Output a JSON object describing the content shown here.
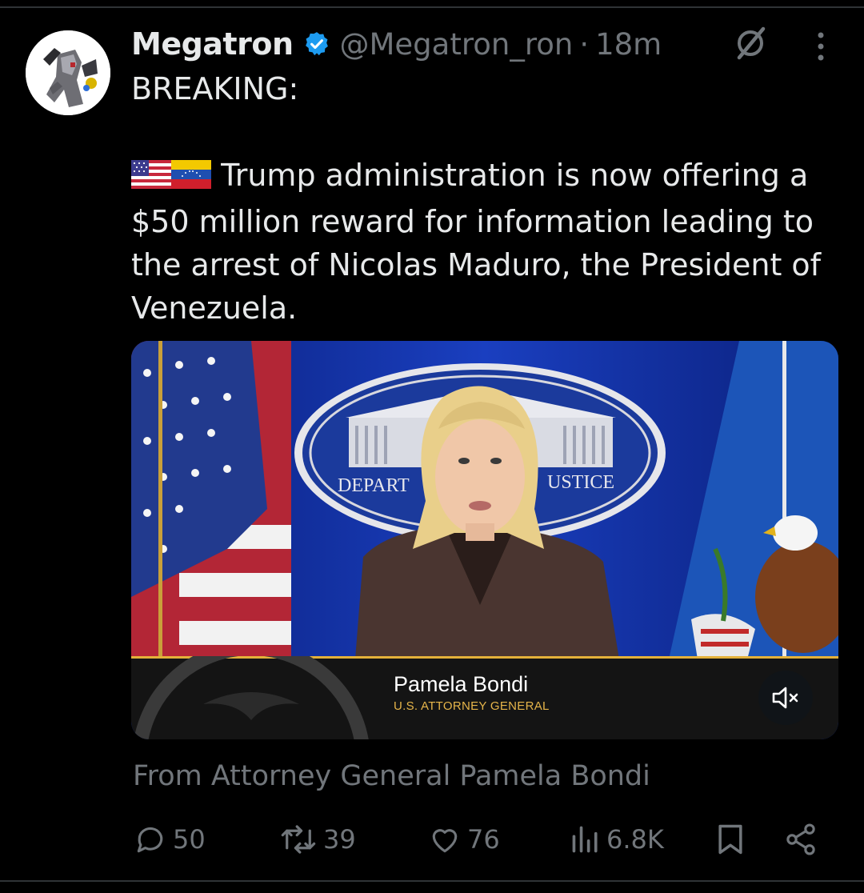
{
  "tweet": {
    "author_name": "Megatron",
    "handle": "@Megatron_ron",
    "separator": "·",
    "time": "18m",
    "text_line1": "BREAKING:",
    "flags": [
      "us-flag",
      "venezuela-flag"
    ],
    "text_body": "Trump administration is now offering a $50 million reward for information leading to the arrest of Nicolas Maduro, the President of Venezuela.",
    "media": {
      "seal_text_left": "DEPART",
      "seal_text_right": "USTICE",
      "lower_third_name": "Pamela Bondi",
      "lower_third_title": "U.S. ATTORNEY GENERAL",
      "mute_icon": "volume-muted-icon"
    },
    "media_caption": "From Attorney General Pamela Bondi"
  },
  "actions": {
    "replies": "50",
    "reposts": "39",
    "likes": "76",
    "views": "6.8K"
  },
  "colors": {
    "background": "#000000",
    "text": "#e7e9ea",
    "muted": "#71767b",
    "verified": "#1d9bf0",
    "lower_third_accent": "#e4b13a"
  }
}
